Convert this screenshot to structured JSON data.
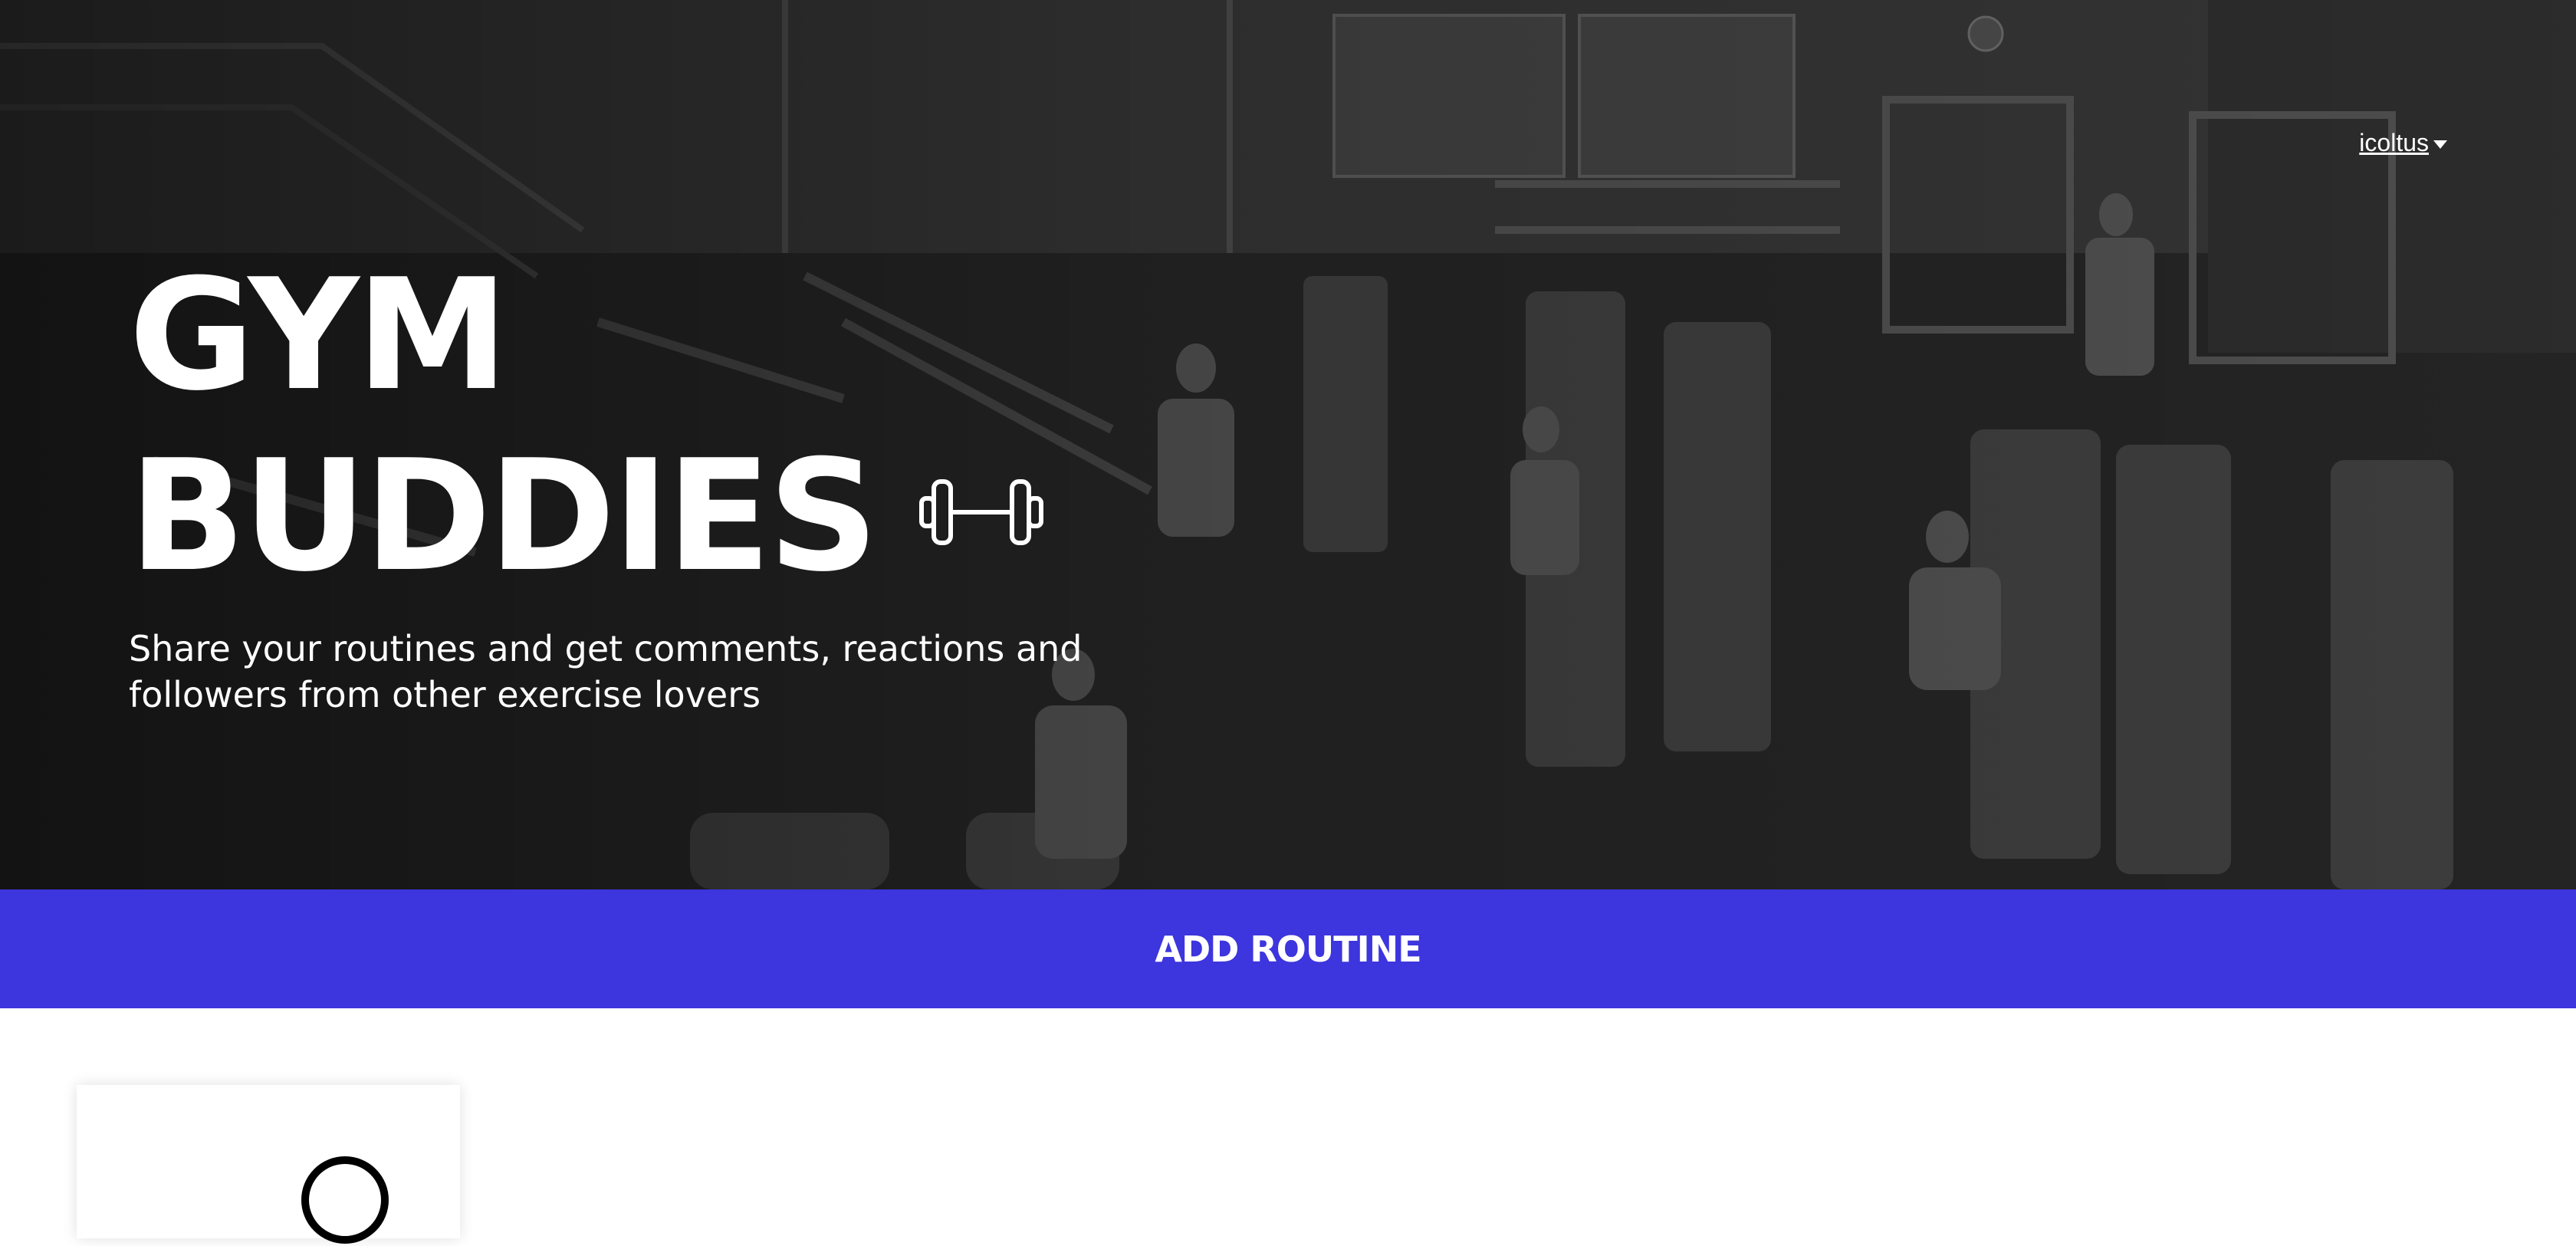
{
  "header": {
    "username": "icoltus",
    "user_menu_icon": "chevron-down-icon"
  },
  "hero": {
    "title_line_1": "GYM",
    "title_line_2": "BUDDIES",
    "title_icon": "dumbbell-icon",
    "tagline": "Share your routines and get comments, reactions and followers from other exercise lovers"
  },
  "actions": {
    "add_routine_label": "ADD ROUTINE"
  },
  "routines": {
    "card_icon": "avatar-icon"
  },
  "colors": {
    "accent": "#3d35dd",
    "hero_text": "#ffffff",
    "hero_bg": "#1e1e1e"
  }
}
